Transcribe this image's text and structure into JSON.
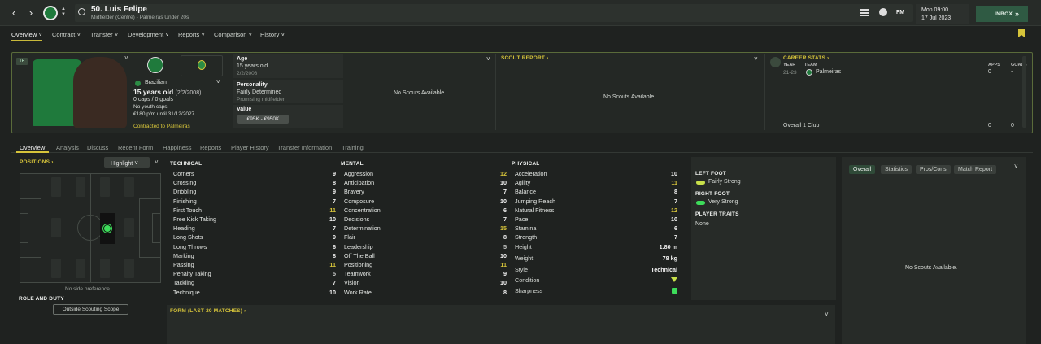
{
  "header": {
    "player_name": "50. Luis Felipe",
    "player_sub": "Midfielder (Centre) - Palmeiras Under 20s",
    "date_time": "Mon 09:00",
    "date": "17 Jul 2023",
    "inbox_label": "INBOX",
    "fm_label": "FM",
    "arrows": "»"
  },
  "menu": [
    {
      "label": "Overview"
    },
    {
      "label": "Contract"
    },
    {
      "label": "Transfer"
    },
    {
      "label": "Development"
    },
    {
      "label": "Reports"
    },
    {
      "label": "Comparison"
    },
    {
      "label": "History"
    }
  ],
  "profile": {
    "nationality": "Brazilian",
    "age_line": "15 years old",
    "dob_inline": "(2/2/2008)",
    "caps": "0 caps / 0 goals",
    "youth_caps": "No youth caps",
    "wage": "€180 p/m until 31/12/2027",
    "contracted": "Contracted to Palmeiras",
    "badge_tag": "TR"
  },
  "info": {
    "age_label": "Age",
    "age_value": "15 years old",
    "dob": "2/2/2008",
    "personality_label": "Personality",
    "personality_value": "Fairly Determined",
    "personality_sub": "Promising midfielder",
    "value_label": "Value",
    "value_range": "€95K - €950K"
  },
  "scouts": {
    "panel1_text": "No Scouts Available.",
    "report_title": "SCOUT REPORT ›",
    "panel2_text": "No Scouts Available."
  },
  "career": {
    "title": "CAREER STATS ›",
    "col_year": "YEAR",
    "col_team": "TEAM",
    "col_apps": "APPS",
    "col_goals": "GOALS",
    "rows": [
      {
        "year": "21-23",
        "team": "Palmeiras",
        "apps": "0",
        "goals": "-"
      }
    ],
    "overall_label": "Overall 1 Club",
    "overall_apps": "0",
    "overall_goals": "0"
  },
  "tabs2": [
    {
      "label": "Overview"
    },
    {
      "label": "Analysis"
    },
    {
      "label": "Discuss"
    },
    {
      "label": "Recent Form"
    },
    {
      "label": "Happiness"
    },
    {
      "label": "Reports"
    },
    {
      "label": "Player History"
    },
    {
      "label": "Transfer Information"
    },
    {
      "label": "Training"
    }
  ],
  "positions": {
    "title": "POSITIONS ›",
    "highlight": "Highlight",
    "side_pref": "No side preference",
    "role_duty": "ROLE AND DUTY",
    "scope": "Outside Scouting Scope"
  },
  "technical": {
    "title": "TECHNICAL",
    "attrs": [
      {
        "name": "Corners",
        "value": "9",
        "tone": "w"
      },
      {
        "name": "Crossing",
        "value": "8",
        "tone": "w"
      },
      {
        "name": "Dribbling",
        "value": "9",
        "tone": "w"
      },
      {
        "name": "Finishing",
        "value": "7",
        "tone": "w"
      },
      {
        "name": "First Touch",
        "value": "11",
        "tone": "y"
      },
      {
        "name": "Free Kick Taking",
        "value": "10",
        "tone": "w"
      },
      {
        "name": "Heading",
        "value": "7",
        "tone": "w"
      },
      {
        "name": "Long Shots",
        "value": "9",
        "tone": "w"
      },
      {
        "name": "Long Throws",
        "value": "6",
        "tone": "w"
      },
      {
        "name": "Marking",
        "value": "8",
        "tone": "w"
      },
      {
        "name": "Passing",
        "value": "11",
        "tone": "y"
      },
      {
        "name": "Penalty Taking",
        "value": "5",
        "tone": "g"
      },
      {
        "name": "Tackling",
        "value": "7",
        "tone": "w"
      },
      {
        "name": "Technique",
        "value": "10",
        "tone": "w"
      }
    ]
  },
  "mental": {
    "title": "MENTAL",
    "attrs": [
      {
        "name": "Aggression",
        "value": "12",
        "tone": "y"
      },
      {
        "name": "Anticipation",
        "value": "10",
        "tone": "w"
      },
      {
        "name": "Bravery",
        "value": "7",
        "tone": "w"
      },
      {
        "name": "Composure",
        "value": "10",
        "tone": "w"
      },
      {
        "name": "Concentration",
        "value": "6",
        "tone": "w"
      },
      {
        "name": "Decisions",
        "value": "7",
        "tone": "w"
      },
      {
        "name": "Determination",
        "value": "15",
        "tone": "y"
      },
      {
        "name": "Flair",
        "value": "8",
        "tone": "w"
      },
      {
        "name": "Leadership",
        "value": "5",
        "tone": "g"
      },
      {
        "name": "Off The Ball",
        "value": "10",
        "tone": "w"
      },
      {
        "name": "Positioning",
        "value": "11",
        "tone": "y"
      },
      {
        "name": "Teamwork",
        "value": "9",
        "tone": "w"
      },
      {
        "name": "Vision",
        "value": "10",
        "tone": "w"
      },
      {
        "name": "Work Rate",
        "value": "8",
        "tone": "w"
      }
    ]
  },
  "physical": {
    "title": "PHYSICAL",
    "attrs": [
      {
        "name": "Acceleration",
        "value": "10",
        "tone": "w"
      },
      {
        "name": "Agility",
        "value": "11",
        "tone": "y"
      },
      {
        "name": "Balance",
        "value": "8",
        "tone": "w"
      },
      {
        "name": "Jumping Reach",
        "value": "7",
        "tone": "w"
      },
      {
        "name": "Natural Fitness",
        "value": "12",
        "tone": "y"
      },
      {
        "name": "Pace",
        "value": "10",
        "tone": "w"
      },
      {
        "name": "Stamina",
        "value": "6",
        "tone": "w"
      },
      {
        "name": "Strength",
        "value": "7",
        "tone": "w"
      }
    ],
    "height_label": "Height",
    "height_value": "1.80 m",
    "weight_label": "Weight",
    "weight_value": "78 kg",
    "style_label": "Style",
    "style_value": "Technical",
    "condition_label": "Condition",
    "sharpness_label": "Sharpness"
  },
  "feet": {
    "left_title": "LEFT FOOT",
    "left_value": "Fairly Strong",
    "right_title": "RIGHT FOOT",
    "right_value": "Very Strong",
    "traits_title": "PLAYER TRAITS",
    "traits_value": "None"
  },
  "form": {
    "title": "FORM (LAST 20 MATCHES) ›"
  },
  "right_panel": {
    "tabs": [
      "Overall",
      "Statistics",
      "Pros/Cons",
      "Match Report"
    ],
    "empty_text": "No Scouts Available."
  },
  "colors": {
    "accent": "#d6c43a",
    "green": "#3ddc5a",
    "club_green": "#1f7a3c"
  }
}
